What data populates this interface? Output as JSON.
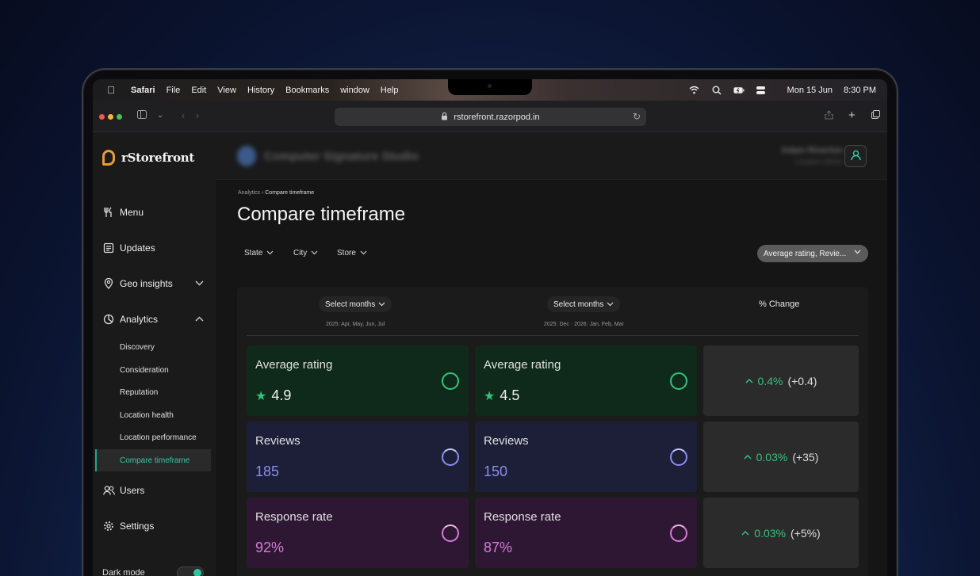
{
  "os_menubar": {
    "app_name": "Safari",
    "menus": [
      "File",
      "Edit",
      "View",
      "History",
      "Bookmarks",
      "window",
      "Help"
    ],
    "date": "Mon 15 Jun",
    "time": "8:30 PM"
  },
  "browser": {
    "url": "rstorefront.razorpod.in"
  },
  "sidebar": {
    "logo": "rStorefront",
    "items": {
      "menu": "Menu",
      "updates": "Updates",
      "geo": "Geo insights",
      "analytics": "Analytics",
      "users": "Users",
      "settings": "Settings"
    },
    "analytics_sub": [
      "Discovery",
      "Consideration",
      "Reputation",
      "Location health",
      "Location performance",
      "Compare timeframe"
    ],
    "dark_mode": "Dark mode"
  },
  "header": {
    "brand_name": "Computer Signature Studio",
    "user_name": "Adam Riverton",
    "user_sub": "Location Admin"
  },
  "breadcrumb": {
    "root": "Analytics",
    "current": "Compare timeframe"
  },
  "page_title": "Compare timeframe",
  "filters": {
    "state": "State",
    "city": "City",
    "store": "Store",
    "metrics": "Average rating, Revie..."
  },
  "compare": {
    "period_a": {
      "label": "Select months",
      "range": "2025: Apr, May, Jun, Jul"
    },
    "period_b": {
      "label": "Select months",
      "range": "2025: Dec · 2026: Jan, Feb, Mar"
    },
    "change_header": "% Change",
    "rows": [
      {
        "label": "Average rating",
        "a": "4.9",
        "b": "4.5",
        "pct": "0.4%",
        "abs": "(+0.4)"
      },
      {
        "label": "Reviews",
        "a": "185",
        "b": "150",
        "pct": "0.03%",
        "abs": "(+35)"
      },
      {
        "label": "Response rate",
        "a": "92%",
        "b": "87%",
        "pct": "0.03%",
        "abs": "(+5%)"
      }
    ]
  },
  "colors": {
    "accent": "#34c9a6",
    "rating_bg": "#0f2a1b",
    "reviews_bg": "#1d1f38",
    "response_bg": "#2e1733",
    "rating_ring": "#35c27c",
    "reviews_ring": "#8b8cf0",
    "response_ring": "#d77ad8",
    "reviews_value": "#8b8cf0",
    "response_value": "#d77ad8"
  }
}
